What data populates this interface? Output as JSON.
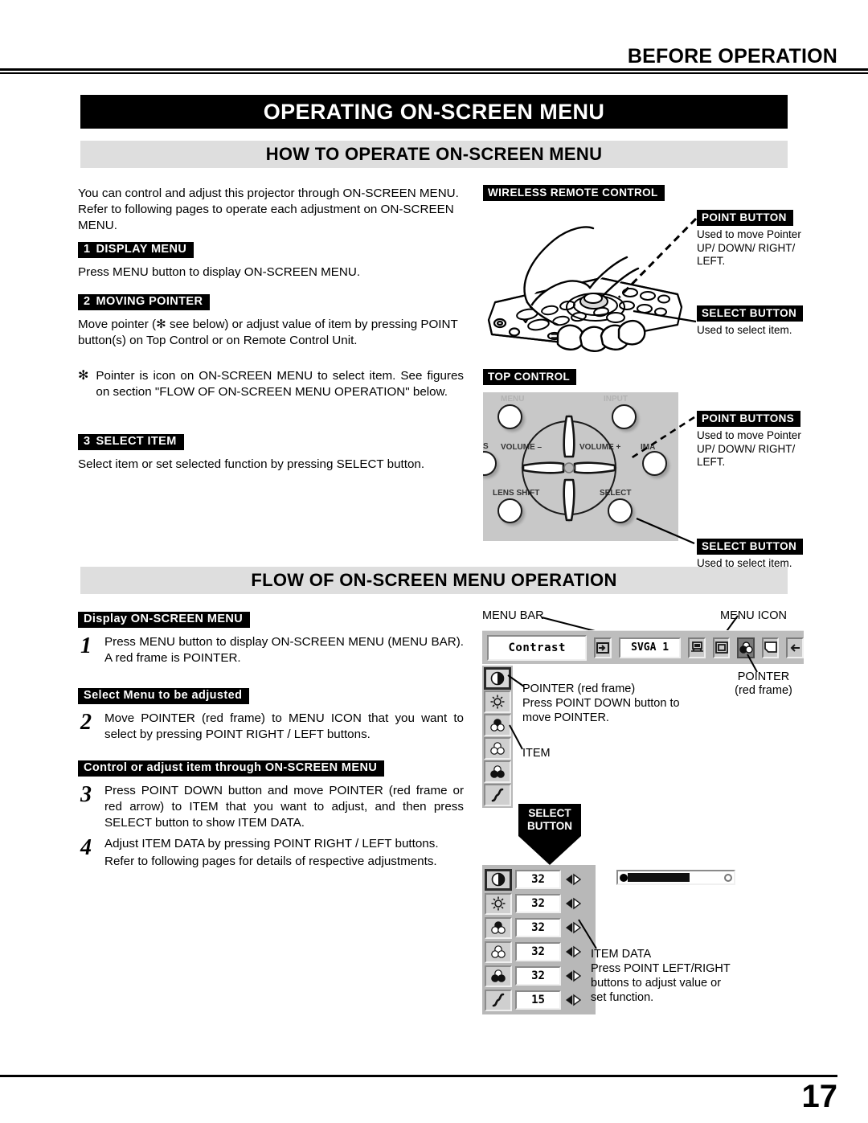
{
  "header": {
    "running_title": "BEFORE OPERATION"
  },
  "title_bar": "OPERATING ON-SCREEN MENU",
  "sections": {
    "how_to": "HOW TO OPERATE ON-SCREEN MENU",
    "flow": "FLOW OF ON-SCREEN MENU OPERATION"
  },
  "intro": "You can control and adjust this projector through ON-SCREEN MENU.  Refer to following pages to operate each adjustment on ON-SCREEN MENU.",
  "steps": [
    {
      "num": "1",
      "tag": "DISPLAY MENU",
      "text": "Press MENU button to display ON-SCREEN MENU."
    },
    {
      "num": "2",
      "tag": "MOVING POINTER",
      "text": "Move pointer (✻ see below) or adjust value of item by pressing POINT button(s) on Top Control or on Remote Control Unit."
    },
    {
      "num": "3",
      "tag": "SELECT ITEM",
      "text": "Select item or set selected function by pressing SELECT button."
    }
  ],
  "footnote": {
    "marker": "✻",
    "text": "Pointer is icon on ON-SCREEN MENU to select item.  See figures on section \"FLOW OF ON-SCREEN MENU OPERATION\" below."
  },
  "remote_figure": {
    "title": "WIRELESS REMOTE CONTROL",
    "callouts": [
      {
        "label": "POINT BUTTON",
        "desc": "Used to move Pointer UP/ DOWN/ RIGHT/ LEFT."
      },
      {
        "label": "SELECT BUTTON",
        "desc": "Used to select item."
      }
    ]
  },
  "topcontrol_figure": {
    "title": "TOP CONTROL",
    "panel_labels": {
      "menu": "MENU",
      "input": "INPUT",
      "volume_minus": "VOLUME –",
      "volume_plus": "VOLUME +",
      "lens_shift": "LENS SHIFT",
      "select": "SELECT",
      "image": "IMA",
      "left_edge": "S"
    },
    "callouts": [
      {
        "label": "POINT BUTTONS",
        "desc": "Used to move Pointer UP/ DOWN/ RIGHT/ LEFT."
      },
      {
        "label": "SELECT BUTTON",
        "desc": "Used to select item."
      }
    ]
  },
  "flow_steps": [
    {
      "tag": "Display ON-SCREEN MENU",
      "num": "1",
      "text": "Press MENU button to display ON-SCREEN MENU (MENU BAR).  A red frame is POINTER."
    },
    {
      "tag": "Select Menu to be adjusted",
      "num": "2",
      "text": "Move POINTER (red frame) to MENU ICON that you want to select by pressing POINT RIGHT / LEFT buttons."
    },
    {
      "tag": "Control or adjust item through ON-SCREEN MENU",
      "num": "3",
      "text": "Press POINT DOWN button and move POINTER (red frame or red arrow) to ITEM that you want to adjust, and then press SELECT button to show ITEM DATA."
    },
    {
      "num": "4",
      "text": "Adjust ITEM DATA by pressing POINT RIGHT / LEFT buttons.",
      "text2": "Refer to following pages for details of respective adjustments."
    }
  ],
  "menu_figure": {
    "labels": {
      "menu_bar": "MENU BAR",
      "menu_icon": "MENU ICON",
      "pointer_right": "POINTER",
      "pointer_right_2": "(red frame)",
      "pointer_left": "POINTER (red frame)",
      "pointer_left_2": "Press POINT DOWN button to",
      "pointer_left_3": "move POINTER.",
      "item": "ITEM",
      "select_button_1": "SELECT",
      "select_button_2": "BUTTON",
      "item_data_1": "ITEM DATA",
      "item_data_2": "Press POINT LEFT/RIGHT",
      "item_data_3": "buttons to adjust value or",
      "item_data_4": "set function."
    },
    "menu_bar": {
      "field_value": "Contrast",
      "source_value": "SVGA 1",
      "icons": [
        "input-icon",
        "computer-icon",
        "square-icon",
        "color-icon",
        "screen-icon",
        "arrow-icon"
      ],
      "selected_icon_index": 3
    },
    "item_data_rows": [
      {
        "icon": "contrast-icon",
        "value": "32",
        "selected": true
      },
      {
        "icon": "brightness-icon",
        "value": "32",
        "selected": false
      },
      {
        "icon": "color-icon",
        "value": "32",
        "selected": false
      },
      {
        "icon": "tint-icon",
        "value": "32",
        "selected": false
      },
      {
        "icon": "white-balance-icon",
        "value": "32",
        "selected": false
      },
      {
        "icon": "gamma-icon",
        "value": "15",
        "selected": false
      }
    ],
    "slider": {
      "fill_percent": 55
    }
  },
  "footer": {
    "page_number": "17"
  },
  "colors": {
    "bar_black": "#000000",
    "section_grey": "#dedede",
    "panel_grey": "#c8c8c8"
  }
}
